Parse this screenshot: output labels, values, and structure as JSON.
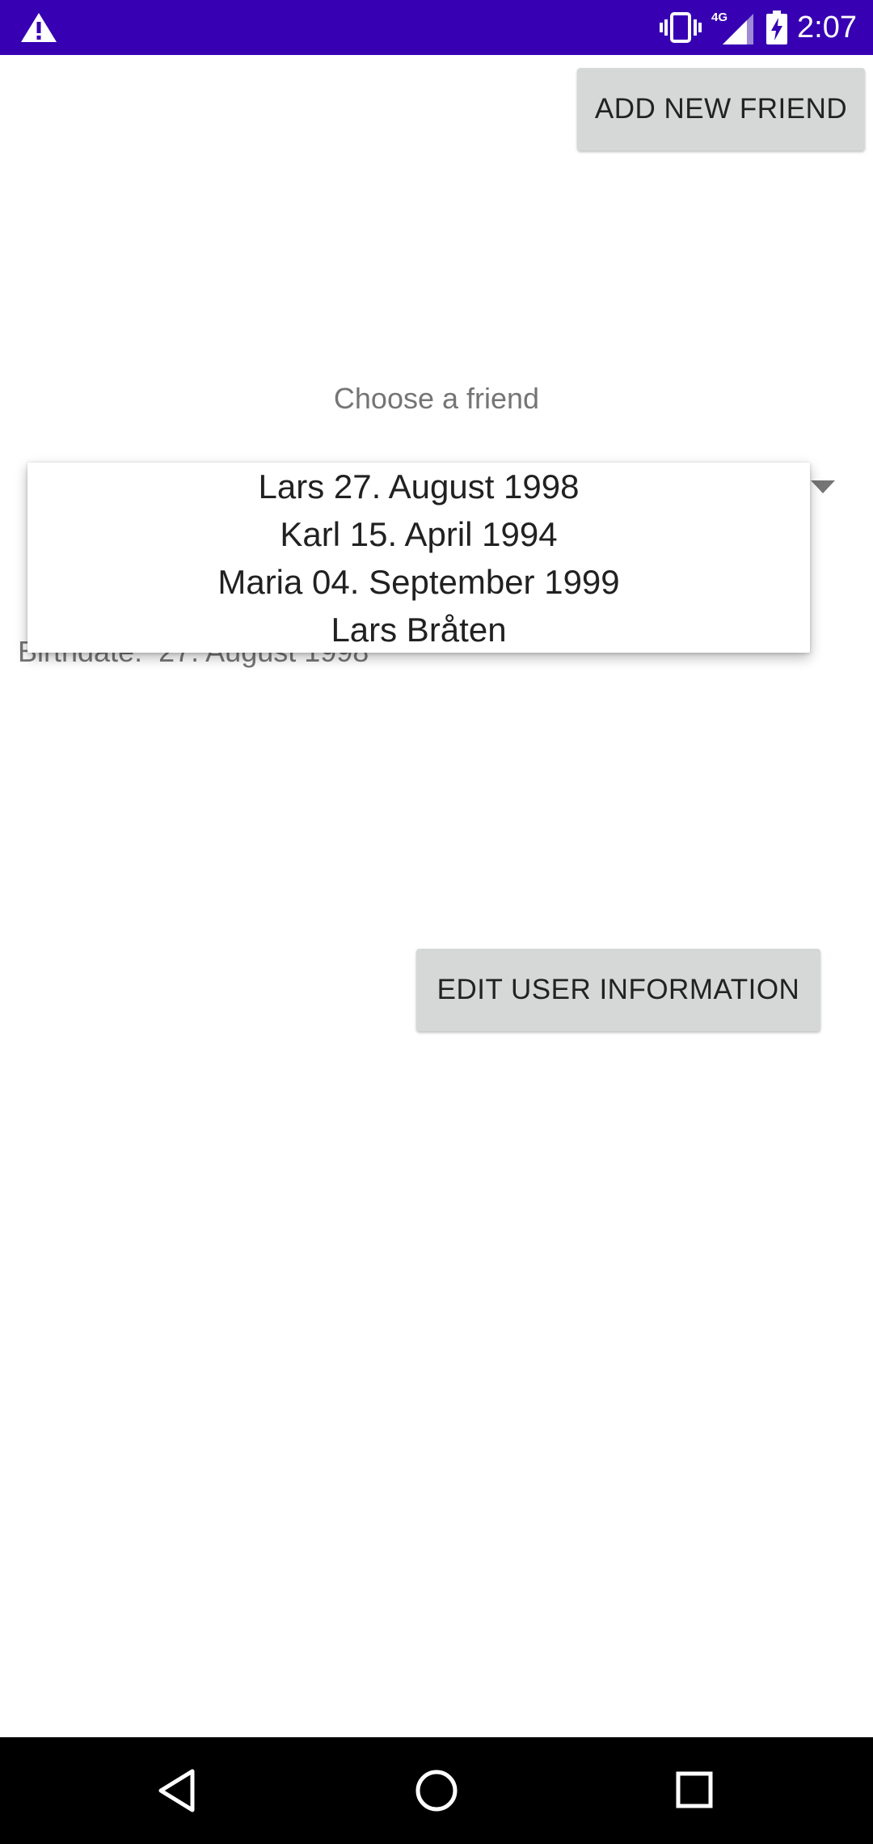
{
  "status_bar": {
    "time": "2:07",
    "network": "4G",
    "color": "#3700b3",
    "icons": [
      "warning-icon",
      "vibrate-icon",
      "signal-icon",
      "battery-charging-icon"
    ]
  },
  "buttons": {
    "add_new_friend": "ADD NEW FRIEND",
    "edit_user_information": "EDIT USER INFORMATION"
  },
  "spinner": {
    "prompt": "Choose a friend",
    "options": [
      "Lars 27. August 1998",
      "Karl 15. April 1994",
      "Maria 04. September 1999",
      "Lars Bråten"
    ]
  },
  "details": {
    "birthdate_text": "Birthdate:  27. August 1998"
  },
  "nav_bar": {
    "icons": [
      "back-icon",
      "home-icon",
      "recents-icon"
    ]
  }
}
